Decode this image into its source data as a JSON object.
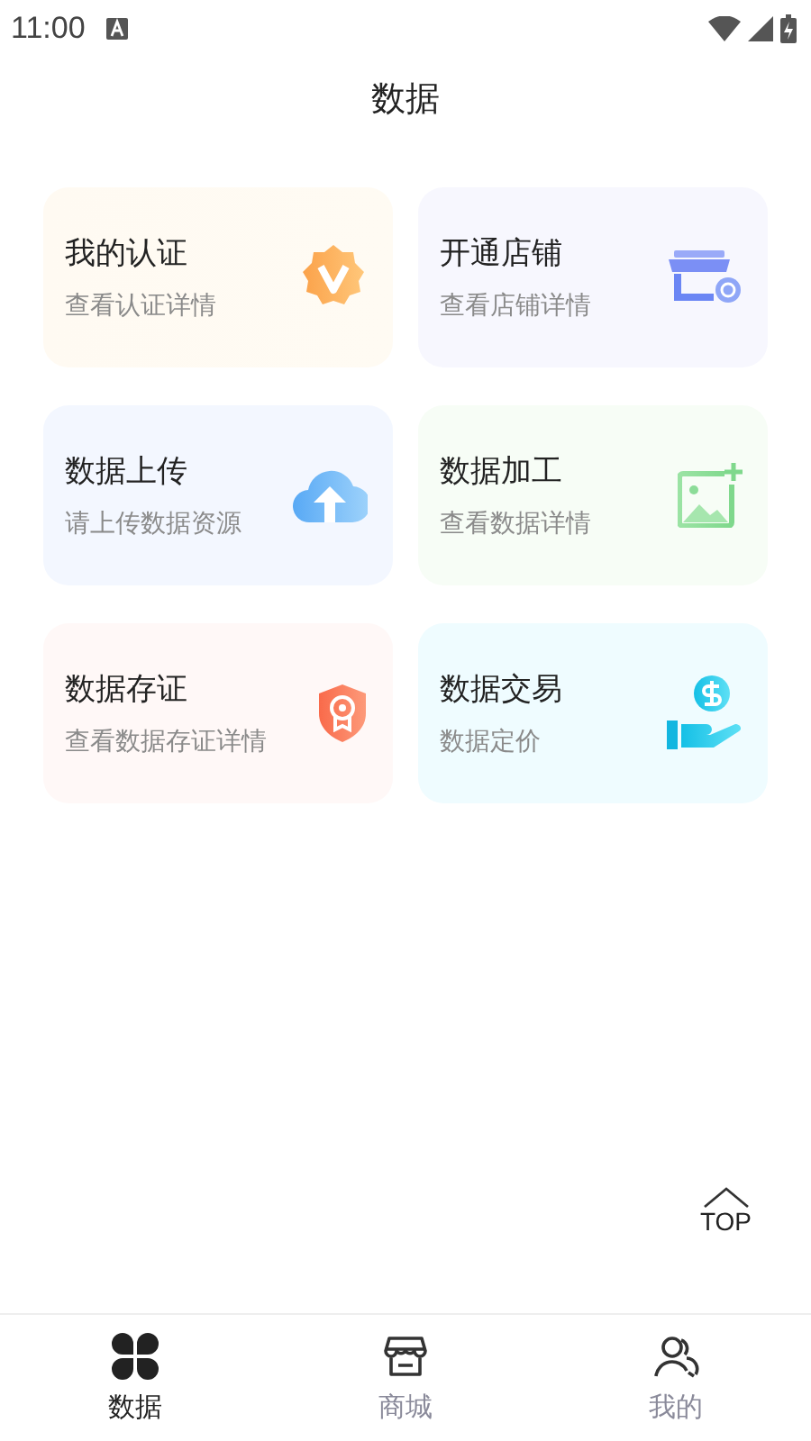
{
  "status_bar": {
    "time": "11:00"
  },
  "header": {
    "title": "数据"
  },
  "cards": [
    {
      "kind": "badge",
      "title": "我的认证",
      "subtitle": "查看认证详情"
    },
    {
      "kind": "store",
      "title": "开通店铺",
      "subtitle": "查看店铺详情"
    },
    {
      "kind": "upload",
      "title": "数据上传",
      "subtitle": "请上传数据资源"
    },
    {
      "kind": "image",
      "title": "数据加工",
      "subtitle": "查看数据详情"
    },
    {
      "kind": "shield",
      "title": "数据存证",
      "subtitle": "查看数据存证详情"
    },
    {
      "kind": "money",
      "title": "数据交易",
      "subtitle": "数据定价"
    }
  ],
  "top_button": {
    "label": "TOP"
  },
  "bottom_nav": [
    {
      "kind": "clover",
      "label": "数据",
      "selected": true
    },
    {
      "kind": "store",
      "label": "商城",
      "selected": false
    },
    {
      "kind": "user",
      "label": "我的",
      "selected": false
    }
  ]
}
